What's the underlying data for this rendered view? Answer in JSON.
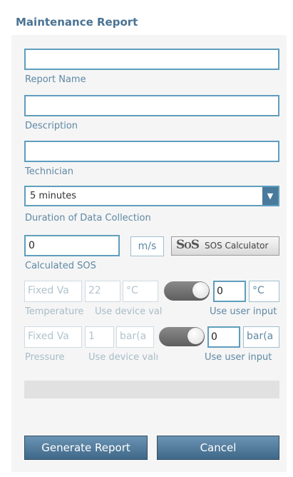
{
  "page": {
    "title": "Maintenance Report"
  },
  "fields": {
    "report_name": {
      "label": "Report Name",
      "value": ""
    },
    "description": {
      "label": "Description",
      "value": ""
    },
    "technician": {
      "label": "Technician",
      "value": ""
    },
    "duration": {
      "label": "Duration of Data Collection",
      "selected": "5 minutes"
    },
    "sos": {
      "label": "Calculated SOS",
      "value": "0",
      "unit": "m/s",
      "calculator_label": "SOS Calculator",
      "calculator_icon": "sos-logo-icon"
    }
  },
  "temperature": {
    "label": "Temperature",
    "device_placeholder": "Fixed Va",
    "device_value": "22",
    "device_unit": "°C",
    "device_caption": "Use device valı",
    "toggle_on": true,
    "user_value": "0",
    "user_unit": "°C",
    "user_caption": "Use user input"
  },
  "pressure": {
    "label": "Pressure",
    "device_placeholder": "Fixed Va",
    "device_value": "1",
    "device_unit": "bar(a",
    "device_caption": "Use device valı",
    "toggle_on": true,
    "user_value": "0",
    "user_unit": "bar(a",
    "user_caption": "Use user input"
  },
  "progress": {
    "fraction": 0
  },
  "actions": {
    "generate_label": "Generate Report",
    "cancel_label": "Cancel"
  },
  "colors": {
    "accent": "#5f9ebd",
    "title": "#4a7393",
    "button": "#4a7a9b"
  }
}
